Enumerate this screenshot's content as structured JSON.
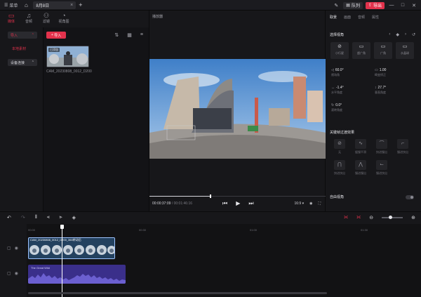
{
  "titlebar": {
    "menu_label": "菜单",
    "tab_title": "8月8日",
    "queue_label": "队列",
    "export_label": "导出"
  },
  "left_nav": {
    "items": [
      {
        "label": "媒体",
        "icon": "folder-icon",
        "active": true
      },
      {
        "label": "音频",
        "icon": "music-note-icon",
        "active": false
      },
      {
        "label": "滤镜",
        "icon": "filter-icon",
        "active": false
      },
      {
        "label": "视角图",
        "icon": "view-icon",
        "active": false
      }
    ]
  },
  "left_sub": {
    "import_label": "导入",
    "local_label": "本地素材",
    "device_label": "设备连接"
  },
  "media": {
    "import_button": "导入",
    "clip_badge": "已添加",
    "clip_name": "CAM_20230808_0012_D200"
  },
  "player": {
    "title": "播放器",
    "current_time": "00:00:37:09",
    "total_time": "00:01:46:16",
    "progress": 0.345,
    "aspect": "16:9"
  },
  "right_panel": {
    "tabs": [
      "取景",
      "画面",
      "音频",
      "属性"
    ],
    "active_tab": 0,
    "view_section": "选择视角",
    "fov_modes": [
      "小行星",
      "超广角",
      "广角",
      "水晶球"
    ],
    "params": [
      {
        "value": "60.0°",
        "label": "视场角"
      },
      {
        "value": "1.00",
        "label": "畸变矫正"
      },
      {
        "value": "-1.4°",
        "label": "水平角度"
      },
      {
        "value": "27.7°",
        "label": "垂直角度"
      },
      {
        "value": "0.0°",
        "label": "滚转角度"
      }
    ],
    "keyframe_section": "关键帧过渡效果",
    "curves": [
      "无",
      "缓慢平滑",
      "快进慢出",
      "慢进快出",
      "快进快出",
      "慢进慢出",
      "慢进快出"
    ],
    "auto_view_label": "自由视角"
  },
  "timeline": {
    "ruler_labels": [
      "00:00",
      "00:30",
      "01:00",
      "01:30"
    ],
    "video_clip_label": "CAM_20230808_0012_D200_360转动后",
    "audio_clip_label": "The Great Wild"
  }
}
